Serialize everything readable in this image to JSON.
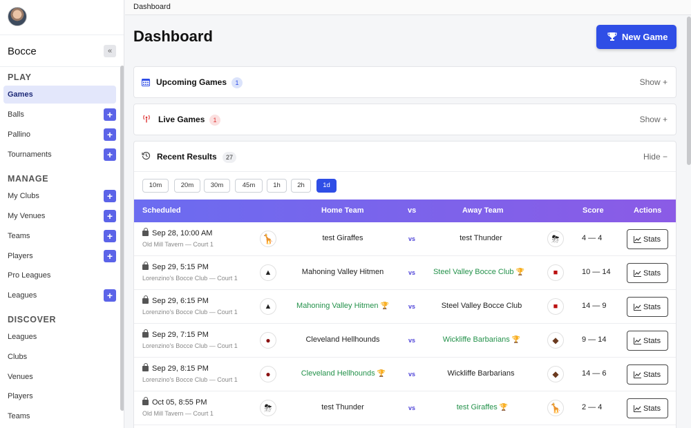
{
  "breadcrumb": "Dashboard",
  "page_title": "Dashboard",
  "new_game_label": "New Game",
  "sidebar": {
    "brand": "Bocce",
    "collapse_label": "«",
    "sections": {
      "play": "PLAY",
      "manage": "MANAGE",
      "discover": "DISCOVER"
    },
    "play_items": [
      "Games",
      "Balls",
      "Pallino",
      "Tournaments"
    ],
    "manage_items": [
      "My Clubs",
      "My Venues",
      "Teams",
      "Players",
      "Pro Leagues",
      "Leagues"
    ],
    "discover_items": [
      "Leagues",
      "Clubs",
      "Venues",
      "Players",
      "Teams"
    ]
  },
  "panels": {
    "upcoming": {
      "title": "Upcoming Games",
      "count": "1",
      "toggle": "Show"
    },
    "live": {
      "title": "Live Games",
      "count": "1",
      "toggle": "Show"
    },
    "recent": {
      "title": "Recent Results",
      "count": "27",
      "toggle": "Hide"
    }
  },
  "filters": [
    "10m",
    "20m",
    "30m",
    "45m",
    "1h",
    "2h",
    "1d"
  ],
  "active_filter": "1d",
  "table": {
    "headers": {
      "scheduled": "Scheduled",
      "home": "Home Team",
      "vs": "vs",
      "away": "Away Team",
      "score": "Score",
      "actions": "Actions"
    },
    "vs_label": "vs",
    "stats_label": "Stats",
    "rows": [
      {
        "date": "Sep 28, 10:00 AM",
        "venue": "Old Mill Tavern — Court 1",
        "home": "test Giraffes",
        "away": "test Thunder",
        "score": "4 — 4"
      },
      {
        "date": "Sep 29, 5:15 PM",
        "venue": "Lorenzino's Bocce Club — Court 1",
        "home": "Mahoning Valley Hitmen",
        "away": "Steel Valley Bocce Club",
        "score": "10 — 14"
      },
      {
        "date": "Sep 29, 6:15 PM",
        "venue": "Lorenzino's Bocce Club — Court 1",
        "home": "Mahoning Valley Hitmen",
        "away": "Steel Valley Bocce Club",
        "score": "14 — 9"
      },
      {
        "date": "Sep 29, 7:15 PM",
        "venue": "Lorenzino's Bocce Club — Court 1",
        "home": "Cleveland Hellhounds",
        "away": "Wickliffe Barbarians",
        "score": "9 — 14"
      },
      {
        "date": "Sep 29, 8:15 PM",
        "venue": "Lorenzino's Bocce Club — Court 1",
        "home": "Cleveland Hellhounds",
        "away": "Wickliffe Barbarians",
        "score": "14 — 6"
      },
      {
        "date": "Oct 05, 8:55 PM",
        "venue": "Old Mill Tavern — Court 1",
        "home": "test Thunder",
        "away": "test Giraffes",
        "score": "2 — 4"
      }
    ]
  },
  "colors": {
    "accent": "#2f4ee6",
    "win": "#23914a",
    "header_start": "#6b6cf0",
    "header_end": "#8b5be6"
  }
}
